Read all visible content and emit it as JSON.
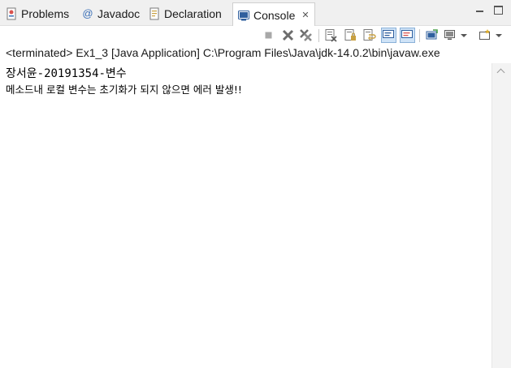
{
  "tabs": [
    {
      "label": "Problems",
      "icon": "problems-icon",
      "active": false
    },
    {
      "label": "Javadoc",
      "icon": "javadoc-icon",
      "active": false
    },
    {
      "label": "Declaration",
      "icon": "declaration-icon",
      "active": false
    },
    {
      "label": "Console",
      "icon": "console-icon",
      "active": true,
      "close": "✕"
    }
  ],
  "toolbar": {
    "icons": [
      "terminate-icon",
      "remove-launch-icon",
      "remove-all-terminated-icon",
      "clear-console-icon",
      "scroll-lock-icon",
      "word-wrap-icon",
      "show-on-stdout-icon",
      "show-on-stderr-icon",
      "pin-console-icon",
      "display-console-icon",
      "open-console-icon"
    ]
  },
  "process_label": "<terminated> Ex1_3 [Java Application] C:\\Program Files\\Java\\jdk-14.0.2\\bin\\javaw.exe",
  "console": {
    "lines": [
      "장서윤-20191354-변수",
      "메소드내 로컬 변수는 초기화가 되지 않으면 에러 발생!!"
    ]
  },
  "colors": {
    "tab_bar_bg": "#f0f0f0",
    "selected_toggle": "#cfe3f7",
    "console_text": "#000000"
  }
}
